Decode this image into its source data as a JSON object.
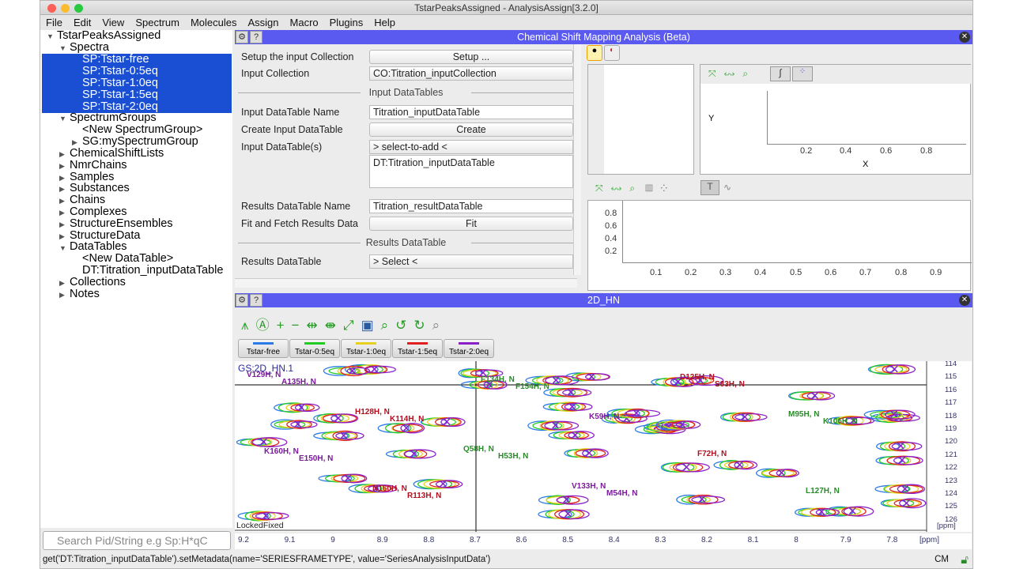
{
  "window": {
    "title": "TstarPeaksAssigned - AnalysisAssign[3.2.0]"
  },
  "menu": [
    "File",
    "Edit",
    "View",
    "Spectrum",
    "Molecules",
    "Assign",
    "Macro",
    "Plugins",
    "Help"
  ],
  "tree": {
    "root": "TstarPeaksAssigned",
    "spectra": "Spectra",
    "spectra_items": [
      "SP:Tstar-free",
      "SP:Tstar-0:5eq",
      "SP:Tstar-1:0eq",
      "SP:Tstar-1:5eq",
      "SP:Tstar-2:0eq"
    ],
    "spectrum_groups": "SpectrumGroups",
    "sg_items": [
      "<New SpectrumGroup>",
      "SG:mySpectrumGroup"
    ],
    "mid": [
      "ChemicalShiftLists",
      "NmrChains",
      "Samples",
      "Substances",
      "Chains",
      "Complexes",
      "StructureEnsembles",
      "StructureData"
    ],
    "datatables": "DataTables",
    "dt_items": [
      "<New DataTable>",
      "DT:Titration_inputDataTable"
    ],
    "tail": [
      "Collections",
      "Notes"
    ]
  },
  "search": {
    "placeholder": "Search Pid/String e.g Sp:H*qC"
  },
  "status": "get('DT:Titration_inputDataTable').setMetadata(name='SERIESFRAMETYPE', value='SeriesAnalysisInputData')",
  "status_right": "CM",
  "csm": {
    "title": "Chemical Shift Mapping Analysis (Beta)",
    "setup_label": "Setup the input Collection",
    "setup_btn": "Setup ...",
    "input_collection_label": "Input Collection",
    "input_collection": "CO:Titration_inputCollection",
    "sect_input": "Input DataTables",
    "idt_name_label": "Input DataTable Name",
    "idt_name": "Titration_inputDataTable",
    "create_label": "Create Input DataTable",
    "create_btn": "Create",
    "idts_label": "Input DataTable(s)",
    "select_add": "> select-to-add <",
    "idts_item": "DT:Titration_inputDataTable",
    "rdt_name_label": "Results DataTable Name",
    "rdt_name": "Titration_resultDataTable",
    "fit_label": "Fit and Fetch Results Data",
    "fit_btn": "Fit",
    "sect_results": "Results DataTable",
    "rdt_label": "Results DataTable",
    "rdt_select": "> Select <"
  },
  "plot_top": {
    "ylabel": "Y",
    "xlabel": "X",
    "xticks": [
      "0.2",
      "0.4",
      "0.6",
      "0.8"
    ]
  },
  "plot_bottom": {
    "yticks": [
      "0.8",
      "0.6",
      "0.4",
      "0.2"
    ],
    "xticks": [
      "0.1",
      "0.2",
      "0.3",
      "0.4",
      "0.5",
      "0.6",
      "0.7",
      "0.8",
      "0.9"
    ]
  },
  "spectrum": {
    "title": "2D_HN",
    "tabs": [
      {
        "label": "Tstar-free",
        "color": "#2a7ae8"
      },
      {
        "label": "Tstar-0:5eq",
        "color": "#22cc22"
      },
      {
        "label": "Tstar-1:0eq",
        "color": "#e8d020"
      },
      {
        "label": "Tstar-1:5eq",
        "color": "#e02020"
      },
      {
        "label": "Tstar-2:0eq",
        "color": "#8a20c8"
      }
    ],
    "group": "GS:2D_HN.1",
    "locked": "LockedFixed",
    "xticks": [
      "9.2",
      "9.1",
      "9",
      "8.9",
      "8.8",
      "8.7",
      "8.6",
      "8.5",
      "8.4",
      "8.3",
      "8.2",
      "8.1",
      "8",
      "7.9",
      "7.8"
    ],
    "xunit": "[ppm]",
    "yticks": [
      "114",
      "115",
      "116",
      "117",
      "118",
      "119",
      "120",
      "121",
      "122",
      "123",
      "124",
      "125",
      "126"
    ],
    "yunit": "[ppm]",
    "peaks": [
      "V129H, N",
      "H128H, N",
      "Q58H, N",
      "V133H, N",
      "D125H, N",
      "M95H, N",
      "K160H, N",
      "N160H, N",
      "F134H, N",
      "K59H, N",
      "F72H, N",
      "L127H, N",
      "A135H, N",
      "K114H, N",
      "H53H, N",
      "M54H, N",
      "S83H, N",
      "K106H, N",
      "E150H, N",
      "R113H, N",
      "F154H, N"
    ]
  }
}
